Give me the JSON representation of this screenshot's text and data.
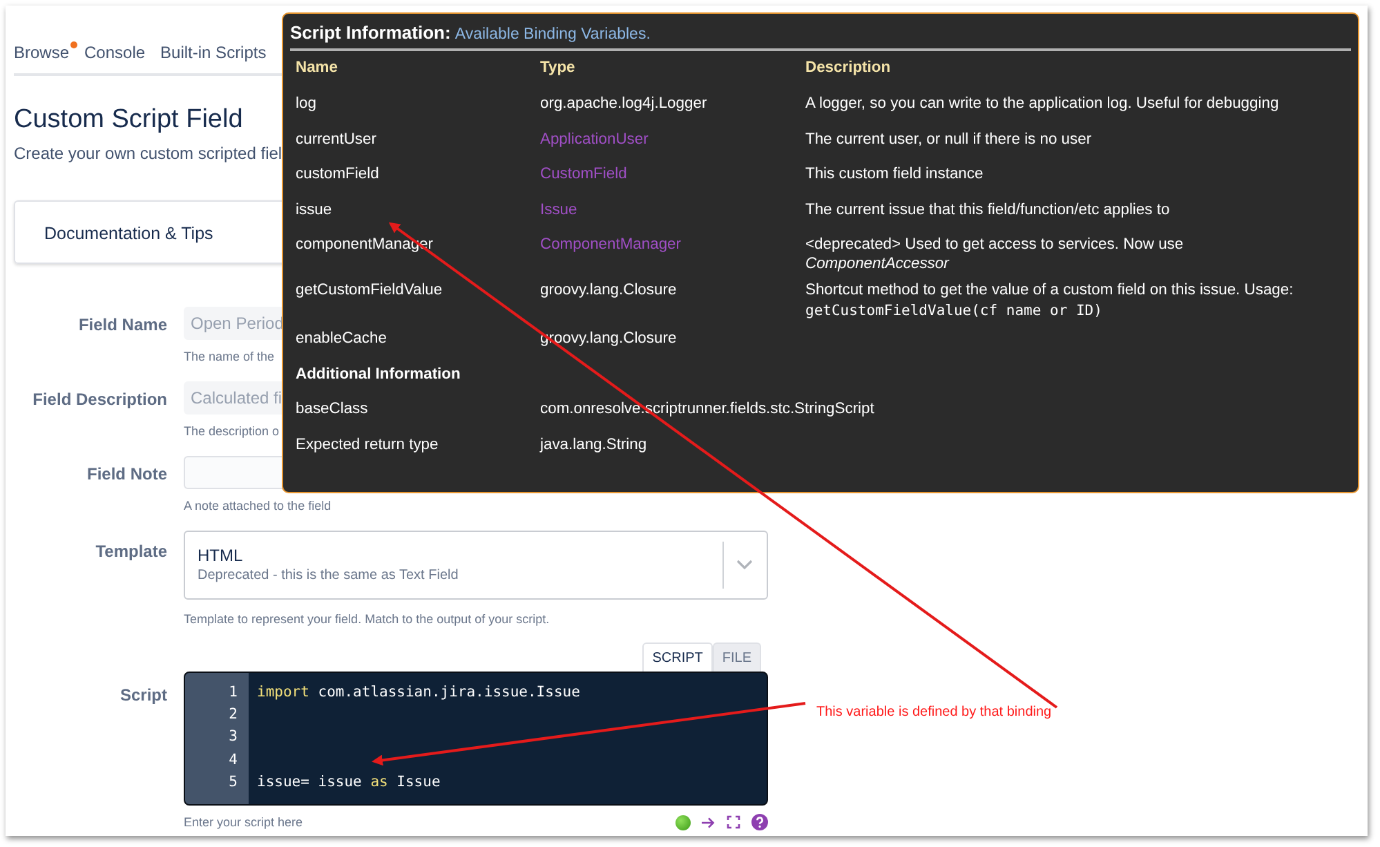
{
  "nav": {
    "items": [
      {
        "label": "Browse",
        "badge": true
      },
      {
        "label": "Console",
        "badge": false
      },
      {
        "label": "Built-in Scripts",
        "badge": false
      }
    ]
  },
  "page": {
    "title": "Custom Script Field",
    "subtitle": "Create your own custom scripted fiel"
  },
  "doc_card": {
    "label": "Documentation & Tips"
  },
  "form": {
    "fields": [
      {
        "kind": "input",
        "label": "Field Name",
        "placeholder": "Open Period",
        "help": "The name of the"
      },
      {
        "kind": "input",
        "label": "Field Description",
        "placeholder": "Calculated fi",
        "help": "The description o"
      },
      {
        "kind": "input",
        "label": "Field Note",
        "help": "A note attached to the field"
      },
      {
        "kind": "select",
        "label": "Template",
        "value": "HTML",
        "detail": "Deprecated - this is the same as Text Field",
        "help": "Template to represent your field. Match to the output of your script."
      },
      {
        "kind": "script",
        "label": "Script",
        "help": "Enter your script here"
      }
    ]
  },
  "script_tabs": [
    {
      "label": "SCRIPT",
      "selected": true
    },
    {
      "label": "FILE",
      "selected": false
    }
  ],
  "editor": {
    "lines": [
      {
        "number": "1",
        "tokens": [
          {
            "text": "import",
            "kind": "keyword"
          },
          {
            "text": " com.atlassian.jira.issue.Issue",
            "kind": "plain"
          }
        ]
      },
      {
        "number": "2"
      },
      {
        "number": "3"
      },
      {
        "number": "4"
      },
      {
        "number": "5",
        "tokens": [
          {
            "text": "issue= issue ",
            "kind": "plain"
          },
          {
            "text": "as",
            "kind": "keyword"
          },
          {
            "text": " Issue",
            "kind": "plain"
          }
        ]
      }
    ]
  },
  "tooltip": {
    "title": "Script Information:",
    "subtitle": "Available Binding Variables.",
    "columns": [
      "Name",
      "Type",
      "Description"
    ],
    "rows": [
      {
        "name": "log",
        "type": "org.apache.log4j.Logger",
        "type_link": false,
        "description": "A logger, so you can write to the application log. Useful for debugging"
      },
      {
        "name": "currentUser",
        "type": "ApplicationUser",
        "type_link": true,
        "description": "The current user, or null if there is no user"
      },
      {
        "name": "customField",
        "type": "CustomField",
        "type_link": true,
        "description": "This custom field instance"
      },
      {
        "name": "issue",
        "type": "Issue",
        "type_link": true,
        "description": "The current issue that this field/function/etc applies to"
      },
      {
        "name": "componentManager",
        "type": "ComponentManager",
        "type_link": true,
        "description": "<deprecated> Used to get access to services. Now use *ComponentAccessor*"
      },
      {
        "name": "getCustomFieldValue",
        "type": "groovy.lang.Closure",
        "type_link": false,
        "description": "Shortcut method to get the value of a custom field on this issue. Usage:",
        "code": "getCustomFieldValue(cf name or ID)"
      },
      {
        "name": "enableCache",
        "type": "groovy.lang.Closure",
        "type_link": false
      }
    ],
    "section_title": "Additional Information",
    "info_rows": [
      {
        "name": "baseClass",
        "type": "com.onresolve.scriptrunner.fields.stc.StringScript"
      },
      {
        "name": "Expected return type",
        "type": "java.lang.String"
      }
    ]
  },
  "annotation": {
    "text": "This variable is defined by that binding"
  }
}
